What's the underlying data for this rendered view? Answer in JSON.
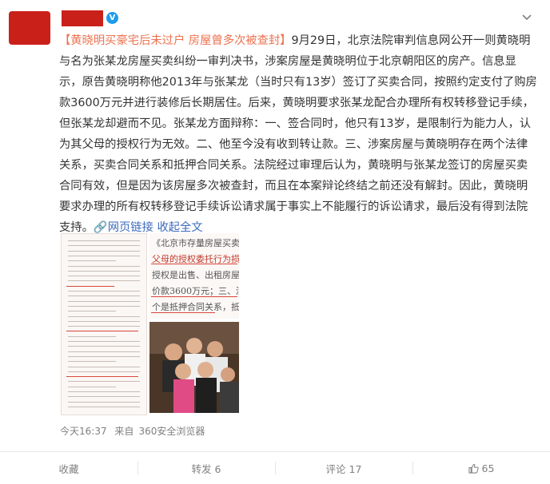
{
  "post": {
    "verified_badge": "V",
    "more_icon": "chevron-down-icon",
    "title_tag": "【黄晓明买豪宅后未过户 房屋曾多次被查封】",
    "body": "9月29日，北京法院审判信息网公开一则黄晓明与名为张某龙房屋买卖纠纷一审判决书，涉案房屋是黄晓明位于北京朝阳区的房产。信息显示，原告黄晓明称他2013年与张某龙（当时只有13岁）签订了买卖合同，按照约定支付了购房款3600万元并进行装修后长期居住。后来，黄晓明要求张某龙配合办理所有权转移登记手续，但张某龙却避而不见。张某龙方面辩称：一、签合同时，他只有13岁，是限制行为能力人，认为其父母的授权行为无效。二、他至今没有收到转让款。三、涉案房屋与黄晓明存在两个法律关系，买卖合同关系和抵押合同关系。法院经过审理后认为，黄晓明与张某龙签订的房屋买卖合同有效，但是因为该房屋多次被查封，而且在本案辩论终结之前还没有解封。因此，黄晓明要求办理的所有权转移登记手续诉讼请求属于事实上不能履行的诉讼请求，最后没有得到法院支持。",
    "web_link": "网页链接",
    "expand": "收起全文",
    "clip_lines": [
      "《北京市存量房屋买卖合",
      "父母的授权委托行为损害",
      "授权是出售、出租房屋等",
      "价款3600万元；三、涉",
      "个是抵押合同关系，抵押"
    ],
    "time": "今天16:37",
    "source_prefix": "来自",
    "source": "360安全浏览器"
  },
  "actions": {
    "favorite": "收藏",
    "repost": "转发 6",
    "comment": "评论 17",
    "like": "65"
  },
  "colors": {
    "brand_red": "#c9201a",
    "link": "#eb7350",
    "blue": "#3e6bbd"
  }
}
